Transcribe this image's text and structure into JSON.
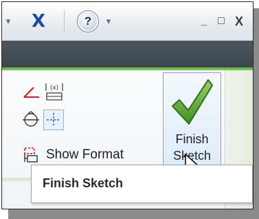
{
  "titlebar": {
    "dropdown_glyph": "▾",
    "app_icon": "X",
    "help_glyph": "?",
    "minimize_glyph": "_",
    "maximize_glyph": "□",
    "close_glyph": "X"
  },
  "ribbon": {
    "show_format_label": "Show Format",
    "finish_sketch_label": "Finish\nSketch"
  },
  "tooltip": {
    "title": "Finish Sketch"
  },
  "colors": {
    "accent_green": "#6fbf4a",
    "selected_border": "#7ea6cf",
    "dark_band": "#454d54"
  }
}
